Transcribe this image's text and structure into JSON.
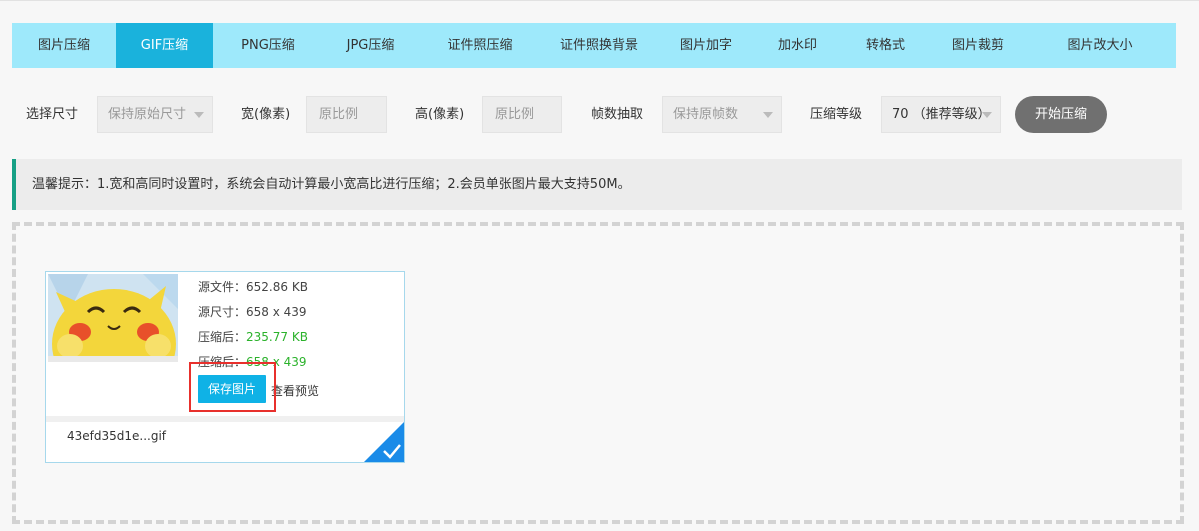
{
  "tabs": [
    {
      "label": "图片压缩",
      "active": false
    },
    {
      "label": "GIF压缩",
      "active": true
    },
    {
      "label": "PNG压缩",
      "active": false
    },
    {
      "label": "JPG压缩",
      "active": false
    },
    {
      "label": "证件照压缩",
      "active": false
    },
    {
      "label": "证件照换背景",
      "active": false
    },
    {
      "label": "图片加字",
      "active": false
    },
    {
      "label": "加水印",
      "active": false
    },
    {
      "label": "转格式",
      "active": false
    },
    {
      "label": "图片裁剪",
      "active": false
    },
    {
      "label": "图片改大小",
      "active": false
    }
  ],
  "options": {
    "size_label": "选择尺寸",
    "size_value": "保持原始尺寸",
    "width_label": "宽(像素)",
    "width_placeholder": "原比例",
    "height_label": "高(像素)",
    "height_placeholder": "原比例",
    "frame_label": "帧数抽取",
    "frame_value": "保持原帧数",
    "level_label": "压缩等级",
    "level_value": "70 （推荐等级）",
    "start_label": "开始压缩"
  },
  "tip": "温馨提示：1.宽和高同时设置时，系统会自动计算最小宽高比进行压缩；2.会员单张图片最大支持50M。",
  "file": {
    "src_size_label": "源文件：",
    "src_size": "652.86 KB",
    "src_dim_label": "源尺寸：",
    "src_dim": "658 x 439",
    "out_size_label": "压缩后：",
    "out_size": "235.77 KB",
    "out_dim_label": "压缩后：",
    "out_dim": "658 x 439",
    "save_label": "保存图片",
    "preview_label": "查看预览",
    "name": "43efd35d1e...gif"
  },
  "colors": {
    "tab_bar": "#9ee9fb",
    "tab_active": "#1ab2dc",
    "accent_green": "#2bb22b",
    "save_button": "#0fb2e6",
    "highlight": "#e8302c"
  }
}
